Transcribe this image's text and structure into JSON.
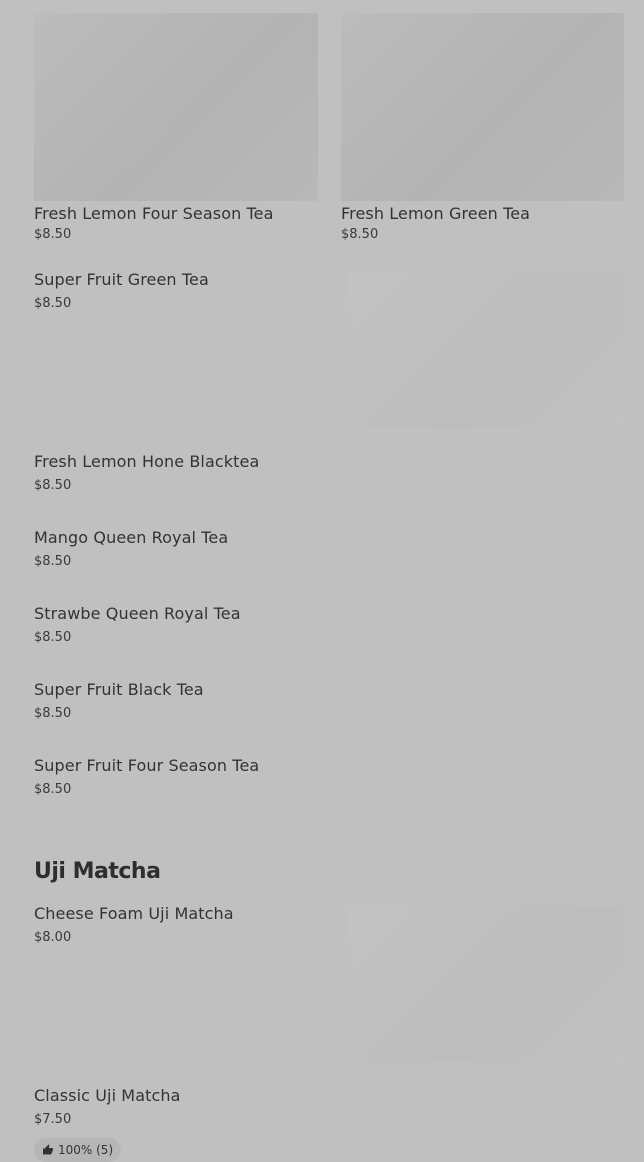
{
  "featured": [
    {
      "name": "Fresh Lemon Four Season Tea",
      "price": "$8.50"
    },
    {
      "name": "Fresh Lemon Green Tea",
      "price": "$8.50"
    }
  ],
  "list_items": [
    {
      "name": "Super Fruit Green Tea",
      "price": "$8.50"
    },
    {
      "name": "Fresh Lemon Hone Blacktea",
      "price": "$8.50"
    },
    {
      "name": "Mango Queen Royal Tea",
      "price": "$8.50"
    },
    {
      "name": "Strawbe Queen Royal Tea",
      "price": "$8.50"
    },
    {
      "name": "Super Fruit Black Tea",
      "price": "$8.50"
    },
    {
      "name": "Super Fruit Four Season Tea",
      "price": "$8.50"
    }
  ],
  "sections": [
    {
      "title": "Uji Matcha",
      "items": [
        {
          "name": "Cheese Foam Uji Matcha",
          "price": "$8.00"
        },
        {
          "name": "Classic Uji Matcha",
          "price": "$7.50",
          "rating": "100% (5)"
        }
      ]
    }
  ],
  "icons": {
    "rating": "thumbs-up-icon"
  }
}
